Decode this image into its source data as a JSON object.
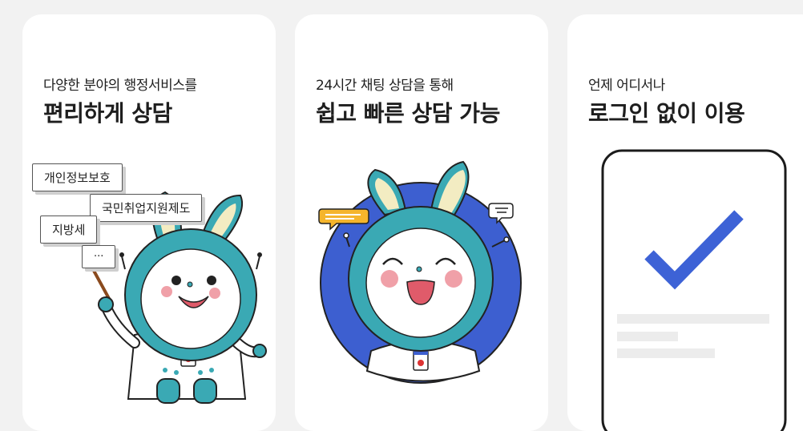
{
  "cards": [
    {
      "subtitle": "다양한 분야의 행정서비스를",
      "title": "편리하게 상담",
      "tags": [
        "개인정보보호",
        "국민취업지원제도",
        "지방세",
        "···"
      ]
    },
    {
      "subtitle": "24시간 채팅 상담을 통해",
      "title": "쉽고 빠른 상담 가능"
    },
    {
      "subtitle": "언제 어디서나",
      "title": "로그인 없이 이용"
    }
  ],
  "colors": {
    "page_background": "#f2f2f2",
    "card_background": "#ffffff",
    "mascot_teal": "#3aa9b4",
    "mascot_ear_inner": "#f3ecc2",
    "blue_circle": "#3d5fd0",
    "checkmark": "#3d62d6",
    "speech_bubble": "#f5b52c"
  }
}
